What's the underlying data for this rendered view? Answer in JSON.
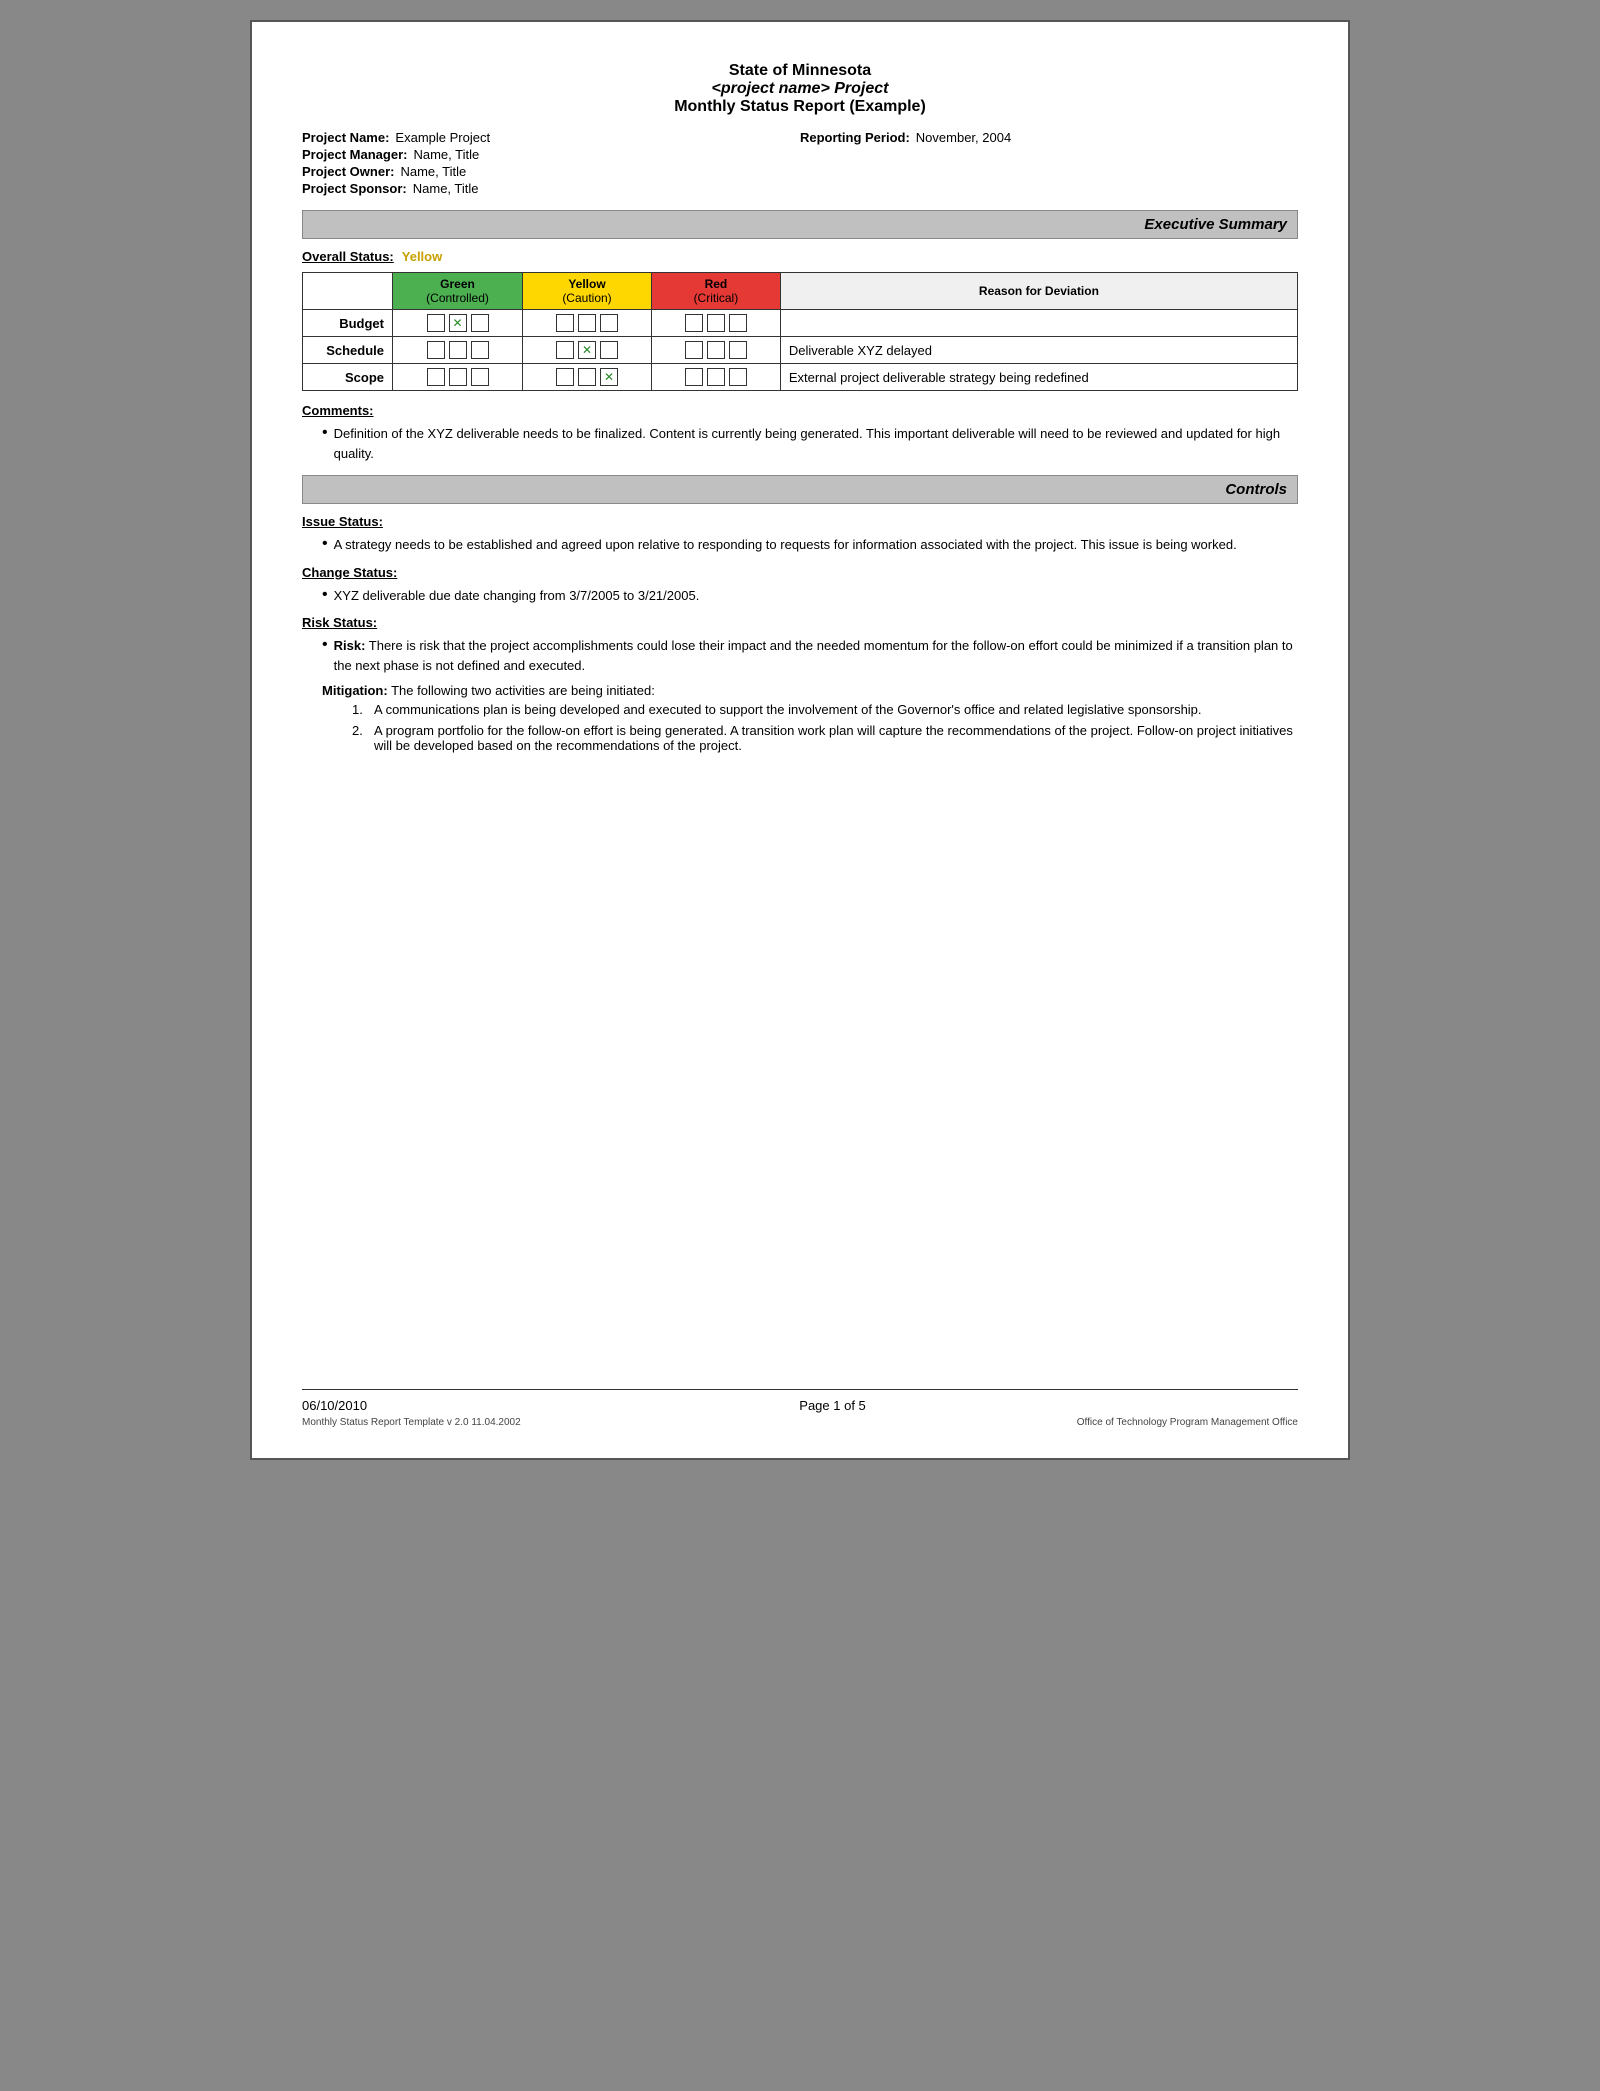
{
  "document": {
    "title_line1": "State of Minnesota",
    "title_line2": "<project name> Project",
    "title_line3": "Monthly Status Report (Example)",
    "meta": {
      "project_name_label": "Project Name:",
      "project_name_value": "Example Project",
      "reporting_period_label": "Reporting Period:",
      "reporting_period_value": "November, 2004",
      "project_manager_label": "Project Manager:",
      "project_manager_value": "Name, Title",
      "project_owner_label": "Project Owner:",
      "project_owner_value": "Name, Title",
      "project_sponsor_label": "Project Sponsor:",
      "project_sponsor_value": "Name, Title"
    }
  },
  "executive_summary": {
    "section_label": "Executive Summary",
    "overall_status_label": "Overall Status:",
    "overall_status_value": "Yellow",
    "table": {
      "col_headers": [
        "Green\n(Controlled)",
        "Yellow\n(Caution)",
        "Red\n(Critical)",
        "Reason for Deviation"
      ],
      "rows": [
        {
          "label": "Budget",
          "green_checked": [
            false,
            true,
            false
          ],
          "yellow_checked": [
            false,
            false,
            false
          ],
          "red_checked": [
            false,
            false,
            false
          ],
          "reason": ""
        },
        {
          "label": "Schedule",
          "green_checked": [
            false,
            false,
            false
          ],
          "yellow_checked": [
            false,
            true,
            false
          ],
          "red_checked": [
            false,
            false,
            false
          ],
          "reason": "Deliverable XYZ delayed"
        },
        {
          "label": "Scope",
          "green_checked": [
            false,
            false,
            false
          ],
          "yellow_checked": [
            false,
            false,
            true
          ],
          "red_checked": [
            false,
            false,
            false
          ],
          "reason": "External project deliverable strategy being redefined"
        }
      ]
    },
    "comments_label": "Comments:",
    "comments": [
      "Definition of the XYZ deliverable needs to be finalized.  Content is currently being generated.  This important deliverable will need to be reviewed and updated for high quality."
    ]
  },
  "controls": {
    "section_label": "Controls",
    "issue_status_label": "Issue Status:",
    "issue_status_items": [
      "A strategy needs to be established and agreed upon relative to responding to requests for information associated with the project.  This issue is being worked."
    ],
    "change_status_label": "Change Status:",
    "change_status_items": [
      "XYZ deliverable due date changing from 3/7/2005 to 3/21/2005."
    ],
    "risk_status_label": "Risk Status:",
    "risk_items": [
      {
        "risk_bold": "Risk:",
        "risk_text": " There is risk that the project accomplishments could lose their impact and the needed momentum for the follow-on effort could be minimized if a transition plan to the next phase is not defined and executed."
      }
    ],
    "mitigation_bold": "Mitigation:",
    "mitigation_intro": " The following two activities are being initiated:",
    "mitigation_items": [
      "A communications plan is being developed and executed to support the involvement of the Governor's office and related legislative sponsorship.",
      "A program portfolio for the follow-on effort is being generated. A transition work plan will capture the recommendations of the project. Follow-on project initiatives will be developed based on the recommendations of the project."
    ]
  },
  "footer": {
    "date": "06/10/2010",
    "page": "Page 1 of 5",
    "template_info": "Monthly Status Report Template  v 2.0  11.04.2002",
    "office": "Office of Technology Program Management Office"
  }
}
